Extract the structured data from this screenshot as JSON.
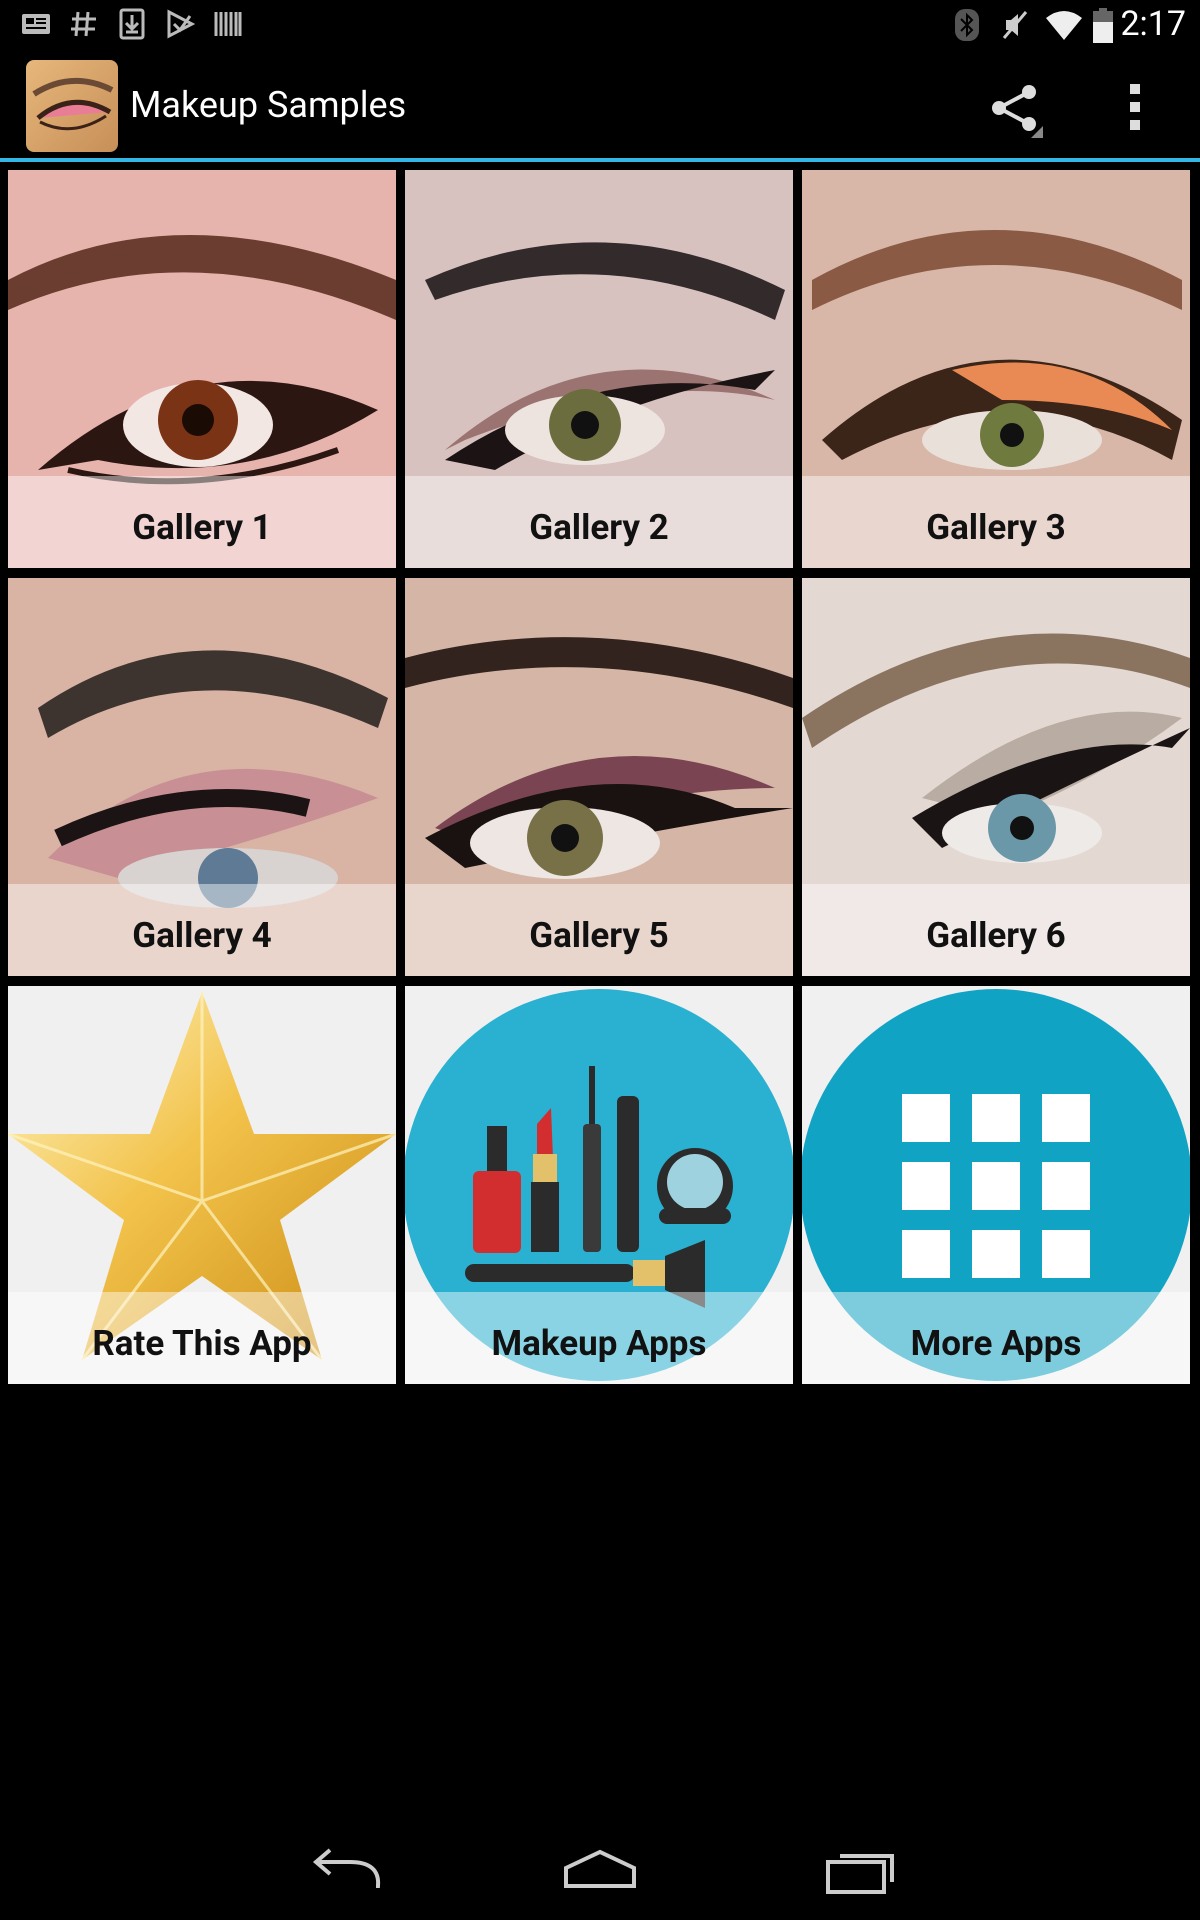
{
  "status_bar": {
    "time": "2:17",
    "left_icons": [
      "news-icon",
      "hash-icon",
      "download-icon",
      "play-store-icon",
      "barcode-icon"
    ],
    "right_icons": [
      "bluetooth-icon",
      "mute-icon",
      "wifi-icon",
      "battery-icon"
    ]
  },
  "action_bar": {
    "title": "Makeup Samples",
    "accent_color": "#33b5e5",
    "actions": [
      "share-icon",
      "overflow-menu-icon"
    ]
  },
  "grid": {
    "tiles": [
      {
        "label": "Gallery 1"
      },
      {
        "label": "Gallery 2"
      },
      {
        "label": "Gallery 3"
      },
      {
        "label": "Gallery 4"
      },
      {
        "label": "Gallery 5"
      },
      {
        "label": "Gallery 6"
      },
      {
        "label": "Rate This App"
      },
      {
        "label": "Makeup Apps"
      },
      {
        "label": "More Apps"
      }
    ]
  },
  "nav_bar": {
    "buttons": [
      "back-icon",
      "home-icon",
      "recent-apps-icon"
    ]
  }
}
